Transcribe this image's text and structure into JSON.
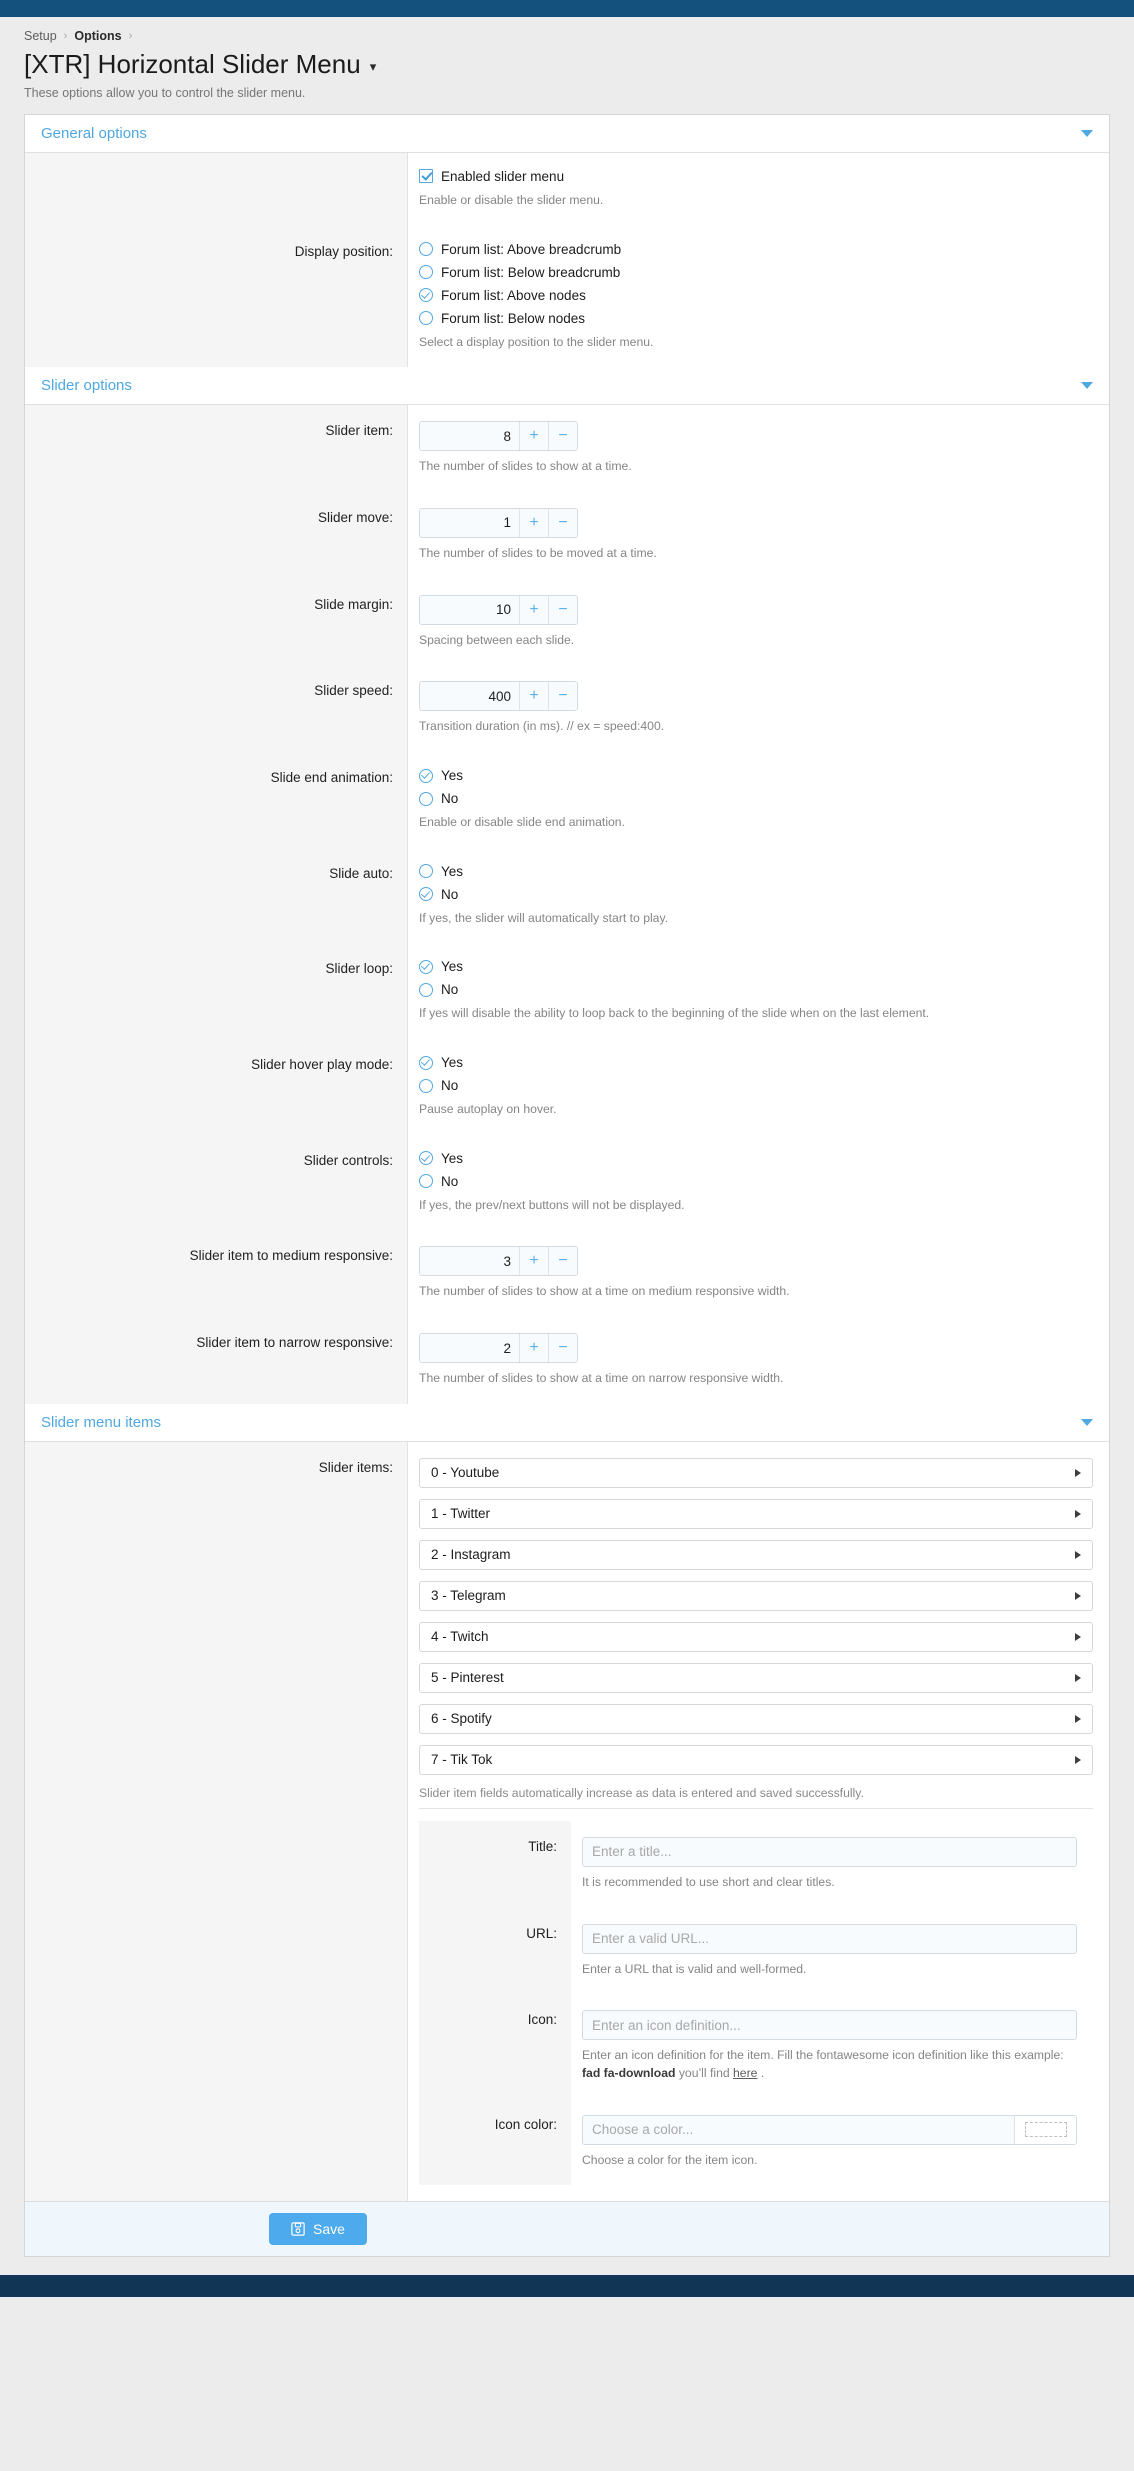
{
  "breadcrumb": {
    "items": [
      "Setup",
      "Options"
    ],
    "separator": "›"
  },
  "page": {
    "title": "[XTR] Horizontal Slider Menu",
    "title_caret": "▾",
    "description": "These options allow you to control the slider menu."
  },
  "sections": {
    "general": {
      "title": "General options"
    },
    "slider": {
      "title": "Slider options"
    },
    "menu_items": {
      "title": "Slider menu items"
    }
  },
  "general": {
    "enabled": {
      "label": "Enabled slider menu",
      "checked": true,
      "hint": "Enable or disable the slider menu."
    },
    "display_position": {
      "label": "Display position:",
      "hint": "Select a display position to the slider menu.",
      "options": [
        {
          "label": "Forum list: Above breadcrumb",
          "selected": false
        },
        {
          "label": "Forum list: Below breadcrumb",
          "selected": false
        },
        {
          "label": "Forum list: Above nodes",
          "selected": true
        },
        {
          "label": "Forum list: Below nodes",
          "selected": false
        }
      ]
    }
  },
  "slider_options": {
    "slider_item": {
      "label": "Slider item:",
      "value": "8",
      "hint": "The number of slides to show at a time.",
      "plus": "+",
      "minus": "−"
    },
    "slider_move": {
      "label": "Slider move:",
      "value": "1",
      "hint": "The number of slides to be moved at a time.",
      "plus": "+",
      "minus": "−"
    },
    "slide_margin": {
      "label": "Slide margin:",
      "value": "10",
      "hint": "Spacing between each slide.",
      "plus": "+",
      "minus": "−"
    },
    "slider_speed": {
      "label": "Slider speed:",
      "value": "400",
      "hint": "Transition duration (in ms). // ex = speed:400.",
      "plus": "+",
      "minus": "−"
    },
    "slide_end_animation": {
      "label": "Slide end animation:",
      "hint": "Enable or disable slide end animation.",
      "options": [
        {
          "label": "Yes",
          "selected": true
        },
        {
          "label": "No",
          "selected": false
        }
      ]
    },
    "slide_auto": {
      "label": "Slide auto:",
      "hint": "If yes, the slider will automatically start to play.",
      "options": [
        {
          "label": "Yes",
          "selected": false
        },
        {
          "label": "No",
          "selected": true
        }
      ]
    },
    "slider_loop": {
      "label": "Slider loop:",
      "hint": "If yes will disable the ability to loop back to the beginning of the slide when on the last element.",
      "options": [
        {
          "label": "Yes",
          "selected": true
        },
        {
          "label": "No",
          "selected": false
        }
      ]
    },
    "slider_hover_play_mode": {
      "label": "Slider hover play mode:",
      "hint": "Pause autoplay on hover.",
      "options": [
        {
          "label": "Yes",
          "selected": true
        },
        {
          "label": "No",
          "selected": false
        }
      ]
    },
    "slider_controls": {
      "label": "Slider controls:",
      "hint": "If yes, the prev/next buttons will not be displayed.",
      "options": [
        {
          "label": "Yes",
          "selected": true
        },
        {
          "label": "No",
          "selected": false
        }
      ]
    },
    "medium_responsive": {
      "label": "Slider item to medium responsive:",
      "value": "3",
      "hint": "The number of slides to show at a time on medium responsive width.",
      "plus": "+",
      "minus": "−"
    },
    "narrow_responsive": {
      "label": "Slider item to narrow responsive:",
      "value": "2",
      "hint": "The number of slides to show at a time on narrow responsive width.",
      "plus": "+",
      "minus": "−"
    }
  },
  "menu_items": {
    "label": "Slider items:",
    "note": "Slider item fields automatically increase as data is entered and saved successfully.",
    "items": [
      {
        "label": "0 - Youtube"
      },
      {
        "label": "1 - Twitter"
      },
      {
        "label": "2 - Instagram"
      },
      {
        "label": "3 - Telegram"
      },
      {
        "label": "4 - Twitch"
      },
      {
        "label": "5 - Pinterest"
      },
      {
        "label": "6 - Spotify"
      },
      {
        "label": "7 - Tik Tok"
      }
    ],
    "fields": {
      "title": {
        "label": "Title:",
        "value": "",
        "placeholder": "Enter a title...",
        "hint": "It is recommended to use short and clear titles."
      },
      "url": {
        "label": "URL:",
        "value": "",
        "placeholder": "Enter a valid URL...",
        "hint": "Enter a URL that is valid and well-formed."
      },
      "icon": {
        "label": "Icon:",
        "value": "",
        "placeholder": "Enter an icon definition...",
        "hint_a": "Enter an icon definition for the item. Fill the fontawesome icon definition like this example: ",
        "hint_b": "fad fa-download",
        "hint_c": " you’ll find ",
        "hint_link": "here",
        "hint_d": " ."
      },
      "icon_color": {
        "label": "Icon color:",
        "value": "",
        "placeholder": "Choose a color...",
        "hint": "Choose a color for the item icon."
      }
    }
  },
  "footer": {
    "save_label": "Save"
  },
  "colors": {
    "accent": "#4fa8e0",
    "topbar": "#14527d",
    "bottombar": "#113655",
    "page_bg": "#ececec",
    "save_button": "#4daaed"
  }
}
